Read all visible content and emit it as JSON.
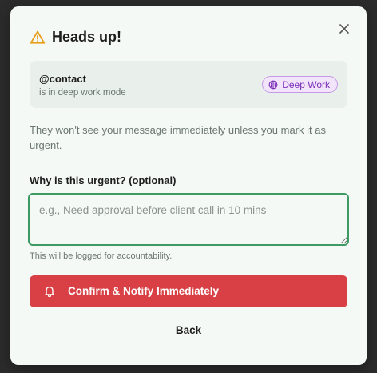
{
  "dialog": {
    "title": "Heads up!",
    "contact": {
      "name": "@contact",
      "status": "is in deep work mode",
      "badge": "Deep Work"
    },
    "description": "They won't see your message immediately unless you mark it as urgent.",
    "reason_label": "Why is this urgent? (optional)",
    "reason_placeholder": "e.g., Need approval before client call in 10 mins",
    "reason_value": "",
    "helper": "This will be logged for accountability.",
    "confirm_label": "Confirm & Notify Immediately",
    "back_label": "Back"
  },
  "colors": {
    "warning": "#e8a020",
    "badge_purple": "#7b2fb8",
    "focus_green": "#3d9a62",
    "danger": "#d94045"
  }
}
